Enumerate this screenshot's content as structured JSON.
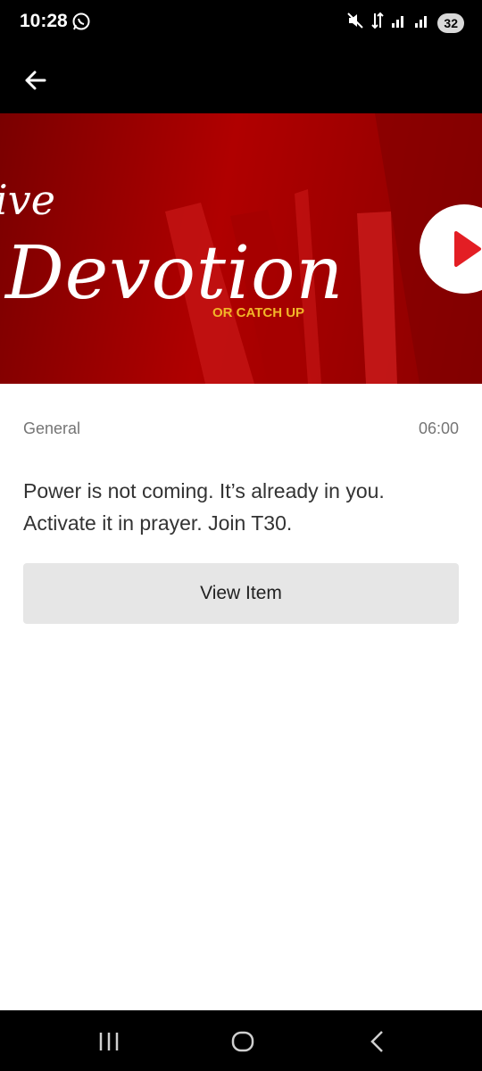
{
  "status_bar": {
    "time": "10:28",
    "battery": "32",
    "icons": [
      "whatsapp-icon",
      "mute-icon",
      "data-icon",
      "signal-icon",
      "signal-icon",
      "battery-icon"
    ]
  },
  "app_bar": {
    "back_icon": "arrow-left-icon"
  },
  "banner": {
    "script_line1": "ive",
    "script_line2": "Devotion",
    "subtitle": "OR CATCH UP",
    "accent_color": "#b00000",
    "play_icon": "play-icon"
  },
  "item": {
    "category": "General",
    "time": "06:00",
    "message": "Power is not coming. It’s already in you. Activate it in prayer. Join T30.",
    "button_label": "View Item"
  },
  "nav_bar": {
    "icons": [
      "recent-apps-icon",
      "home-icon",
      "back-icon"
    ]
  }
}
